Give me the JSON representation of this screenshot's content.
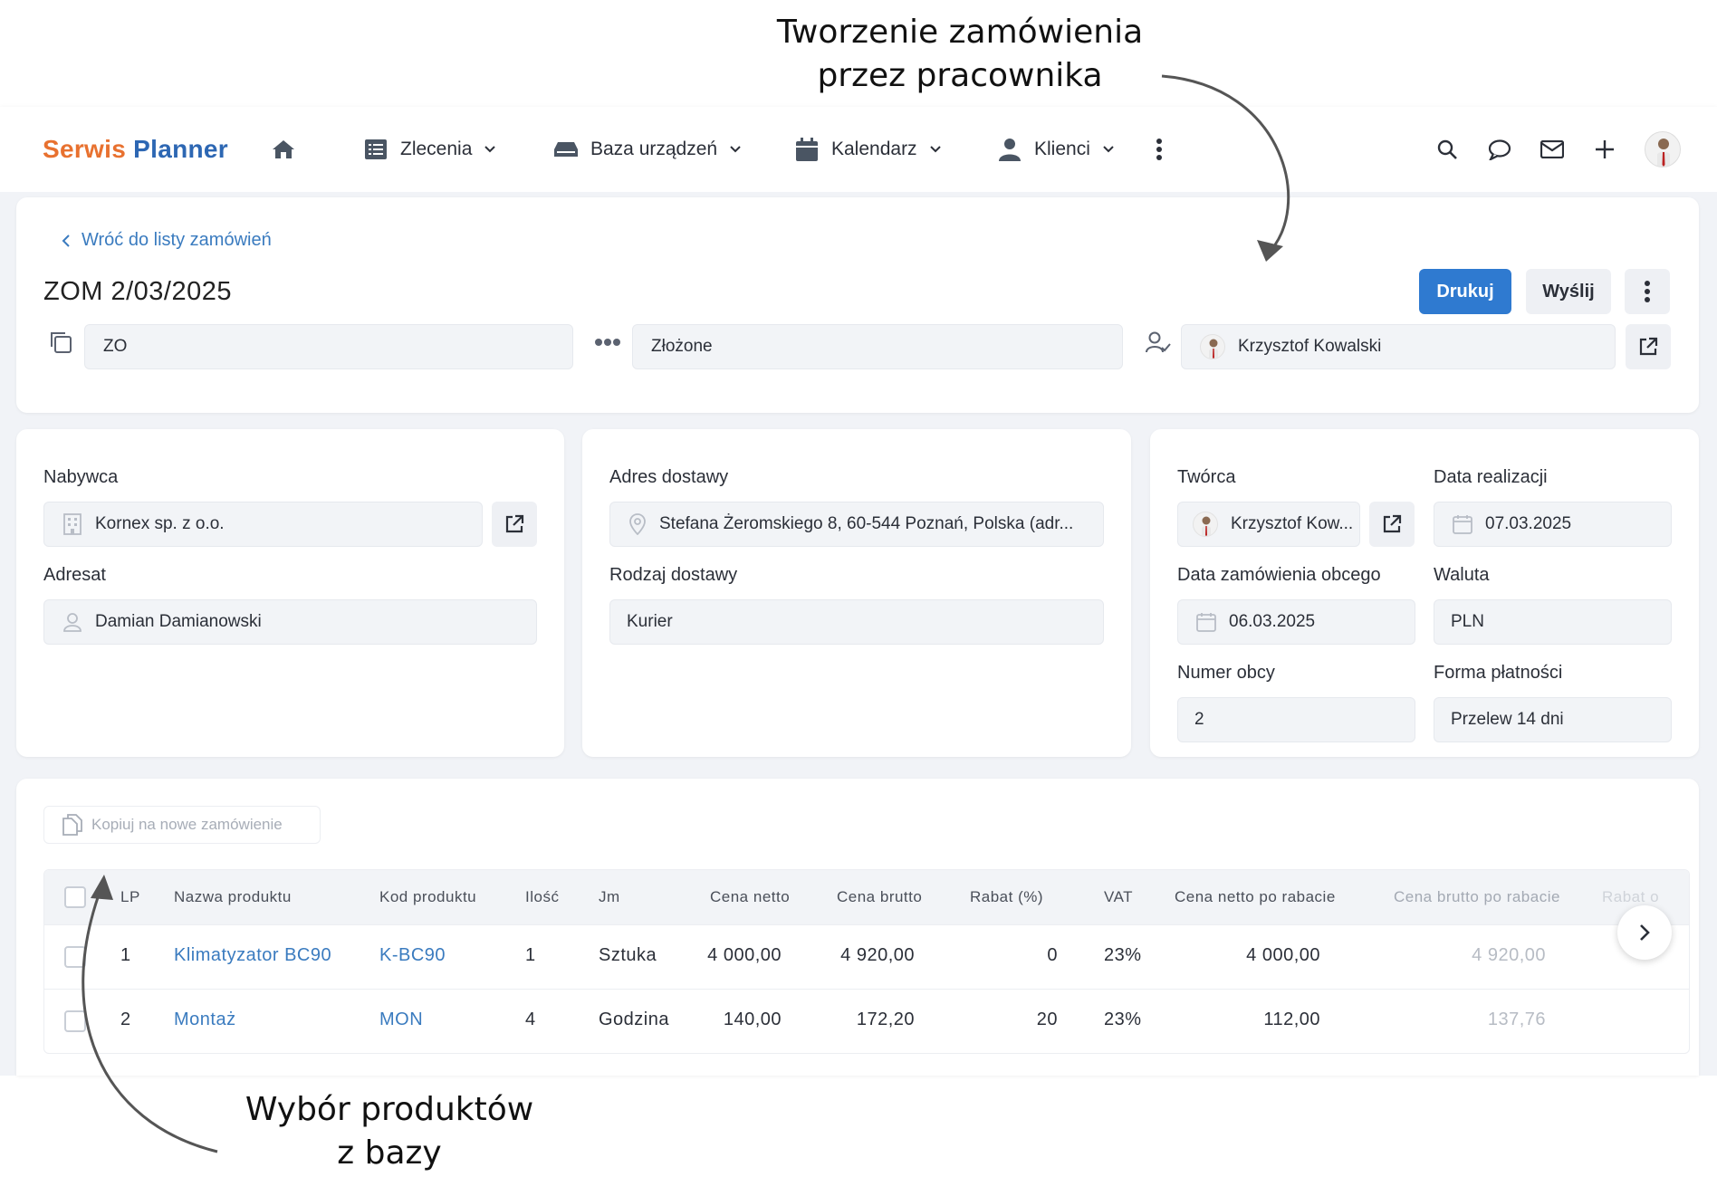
{
  "annotations": {
    "top_line1": "Tworzenie zamówienia",
    "top_line2": "przez pracownika",
    "bottom_line1": "Wybór produktów",
    "bottom_line2": "z bazy"
  },
  "navbar": {
    "logo_part1": "Serwis",
    "logo_part2": "Planner",
    "items": [
      {
        "label": "Zlecenia",
        "icon": "list-icon"
      },
      {
        "label": "Baza urządzeń",
        "icon": "device-icon"
      },
      {
        "label": "Kalendarz",
        "icon": "calendar-icon"
      },
      {
        "label": "Klienci",
        "icon": "user-icon"
      }
    ]
  },
  "header": {
    "back_label": "Wróć do listy zamówień",
    "title": "ZOM 2/03/2025",
    "print_label": "Drukuj",
    "send_label": "Wyślij",
    "type_value": "ZO",
    "status_value": "Złożone",
    "assignee_value": "Krzysztof Kowalski"
  },
  "buyer_card": {
    "buyer_label": "Nabywca",
    "buyer_value": "Kornex sp. z o.o.",
    "recipient_label": "Adresat",
    "recipient_value": "Damian Damianowski"
  },
  "delivery_card": {
    "address_label": "Adres dostawy",
    "address_value": "Stefana Żeromskiego 8, 60-544 Poznań, Polska (adr...",
    "type_label": "Rodzaj dostawy",
    "type_value": "Kurier"
  },
  "meta_card": {
    "creator_label": "Twórca",
    "creator_value": "Krzysztof Kow...",
    "realization_label": "Data realizacji",
    "realization_value": "07.03.2025",
    "foreign_date_label": "Data zamówienia obcego",
    "foreign_date_value": "06.03.2025",
    "currency_label": "Waluta",
    "currency_value": "PLN",
    "foreign_number_label": "Numer obcy",
    "foreign_number_value": "2",
    "payment_label": "Forma płatności",
    "payment_value": "Przelew 14 dni"
  },
  "products": {
    "copy_label": "Kopiuj na nowe zamówienie",
    "columns": [
      "LP",
      "Nazwa produktu",
      "Kod produktu",
      "Ilość",
      "Jm",
      "Cena netto",
      "Cena brutto",
      "Rabat (%)",
      "VAT",
      "Cena netto po rabacie",
      "Cena brutto po rabacie",
      "Rabat o"
    ],
    "rows": [
      [
        "1",
        "Klimatyzator BC90",
        "K-BC90",
        "1",
        "Sztuka",
        "4 000,00",
        "4 920,00",
        "0",
        "23%",
        "4 000,00",
        "4 920,00"
      ],
      [
        "2",
        "Montaż",
        "MON",
        "4",
        "Godzina",
        "140,00",
        "172,20",
        "20",
        "23%",
        "112,00",
        "137,76"
      ]
    ]
  }
}
